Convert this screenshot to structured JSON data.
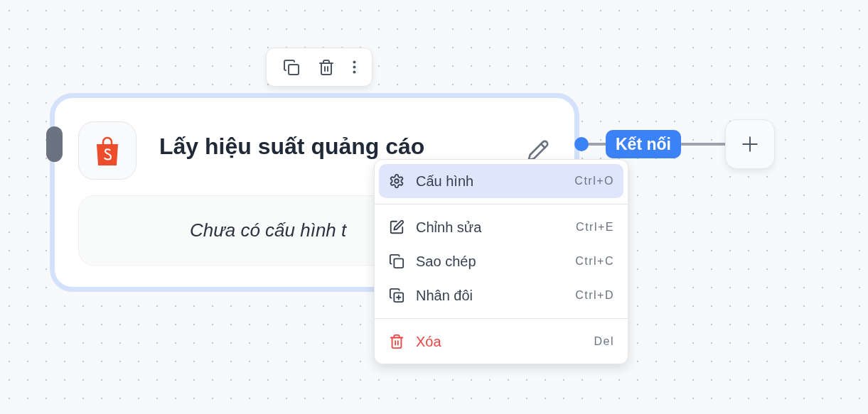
{
  "node": {
    "title": "Lấy hiệu suất quảng cáo",
    "placeholder_text": "Chưa có cấu hình t",
    "selected": true
  },
  "connection": {
    "label": "Kết nối"
  },
  "context_menu": {
    "groups": [
      [
        {
          "kind": "configure",
          "label": "Cấu hình",
          "shortcut": "Ctrl+O",
          "selected": true
        }
      ],
      [
        {
          "kind": "edit",
          "label": "Chỉnh sửa",
          "shortcut": "Ctrl+E",
          "selected": false
        },
        {
          "kind": "copy",
          "label": "Sao chép",
          "shortcut": "Ctrl+C",
          "selected": false
        },
        {
          "kind": "duplicate",
          "label": "Nhân đôi",
          "shortcut": "Ctrl+D",
          "selected": false
        }
      ],
      [
        {
          "kind": "delete",
          "label": "Xóa",
          "shortcut": "Del",
          "selected": false
        }
      ]
    ]
  }
}
